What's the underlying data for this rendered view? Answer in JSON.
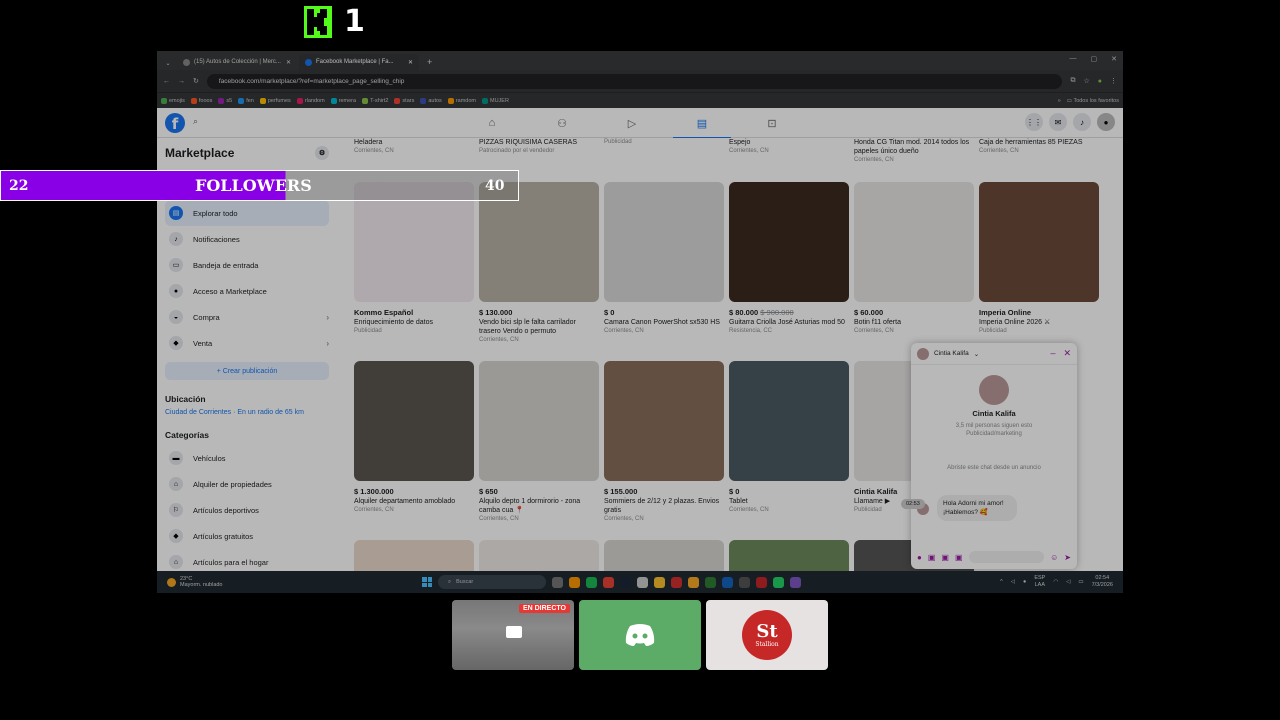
{
  "overlay": {
    "kick_number": "1",
    "followers_count": "22",
    "followers_label": "FOLLOWERS",
    "followers_goal": "40",
    "followers_progress": 0.55
  },
  "browser": {
    "tabs": [
      {
        "label": "(15) Autos de Colección | Merc..."
      },
      {
        "label": "Facebook Marketplace | Fa..."
      }
    ],
    "new_tab": "+",
    "url": "facebook.com/marketplace/?ref=marketplace_page_selling_chip",
    "bookmarks": [
      "emojis",
      "fooos",
      "s5",
      "fen",
      "perfumes",
      "rlandom",
      "remera",
      "T-shirt2",
      "stars",
      "autos",
      "ramdom",
      "MUJER"
    ],
    "bookmarks_more": "»",
    "all_bookmarks": "Todos los favoritos"
  },
  "sidebar": {
    "title": "Marketplace",
    "items": [
      {
        "label": "Explorar todo",
        "icon": "store-icon"
      },
      {
        "label": "Notificaciones",
        "icon": "bell-icon"
      },
      {
        "label": "Bandeja de entrada",
        "icon": "inbox-icon"
      },
      {
        "label": "Acceso a Marketplace",
        "icon": "user-icon"
      },
      {
        "label": "Compra",
        "icon": "bag-icon"
      },
      {
        "label": "Venta",
        "icon": "tag-icon"
      }
    ],
    "create_listing": "+ Crear publicación",
    "location_heading": "Ubicación",
    "location_value": "Ciudad de Corrientes · En un radio de 65 km",
    "categories_heading": "Categorías",
    "categories": [
      {
        "label": "Vehículos"
      },
      {
        "label": "Alquiler de propiedades"
      },
      {
        "label": "Artículos deportivos"
      },
      {
        "label": "Artículos gratuitos"
      },
      {
        "label": "Artículos para el hogar"
      }
    ]
  },
  "top_row": [
    {
      "title": "Heladera",
      "sub": "Corrientes, CN"
    },
    {
      "title": "PIZZAS RIQUISIMA CASERAS",
      "sub": "Patrocinado por el vendedor"
    },
    {
      "title": "",
      "sub": "Publicidad"
    },
    {
      "title": "Espejo",
      "sub": "Corrientes, CN"
    },
    {
      "title": "Honda CG Titan mod. 2014 todos los papeles único dueño",
      "sub": "Corrientes, CN"
    },
    {
      "title": "Caja de herramientas 85 PIEZAS",
      "sub": "Corrientes, CN"
    }
  ],
  "row1": [
    {
      "price": "Kommo Español",
      "old": "",
      "title": "Enriquecimiento de datos",
      "sub": "Publicidad",
      "bg": "#f3e9ef"
    },
    {
      "price": "$ 130.000",
      "old": "",
      "title": "Vendo bici slp le falta carrilador trasero Vendo o permuto",
      "sub": "Corrientes, CN",
      "bg": "#b9b2a6"
    },
    {
      "price": "$ 0",
      "old": "",
      "title": "Camara Canon PowerShot sx530 HS",
      "sub": "Corrientes, CN",
      "bg": "#d9d9d9"
    },
    {
      "price": "$ 80.000",
      "old": "$ 900.000",
      "title": "Guitarra Criolla José Asturias mod 50",
      "sub": "Resistencia, CC",
      "bg": "#3b2a1f"
    },
    {
      "price": "$ 60.000",
      "old": "",
      "title": "Botin f11 oferta",
      "sub": "Corrientes, CN",
      "bg": "#e9e6e3"
    },
    {
      "price": "Imperia Online",
      "old": "",
      "title": "Imperia Online 2026 ⚔",
      "sub": "Publicidad",
      "bg": "#6b4a3a"
    }
  ],
  "row2": [
    {
      "price": "$ 1.300.000",
      "title": "Alquiler departamento amoblado",
      "sub": "Corrientes, CN",
      "bg": "#5a5650"
    },
    {
      "price": "$ 650",
      "title": "Alquilo depto 1 dormirorio - zona camba cua 📍",
      "sub": "Corrientes, CN",
      "bg": "#d6d4cf"
    },
    {
      "price": "$ 155.000",
      "title": "Sommiers de 2/12 y 2 plazas. Envios gratis",
      "sub": "Corrientes, CN",
      "bg": "#8a6e5c"
    },
    {
      "price": "$ 0",
      "title": "Tablet",
      "sub": "Corrientes, CN",
      "bg": "#4a5a62"
    },
    {
      "price": "Cintia Kalifa",
      "title": "Llamame ▶",
      "sub": "Publicidad",
      "bg": "#e8e4e4"
    }
  ],
  "messenger": {
    "name": "Cintia Kalifa",
    "followers": "3,5 mil personas siguen esto",
    "category": "Publicidad/marketing",
    "notice": "Abriste este chat desde un anuncio",
    "message": "Hola  Adorni mi amor! ¡Hablemos? 🥰",
    "time": "02:53"
  },
  "taskbar": {
    "weather_temp": "23°C",
    "weather_desc": "Mayorm. nublado",
    "search_placeholder": "Buscar",
    "lang1": "ESP",
    "lang2": "LAA",
    "clock_time": "02:54",
    "clock_date": "7/3/2026"
  },
  "tiles": {
    "live_label": "EN DIRECTO",
    "st_label": "St",
    "st_sub": "Stallion"
  },
  "colors": {
    "accent": "#1877f2",
    "followers_bar": "#8a00e6",
    "kick_green": "#53fc18",
    "messenger_purple": "#9b1aa5"
  }
}
